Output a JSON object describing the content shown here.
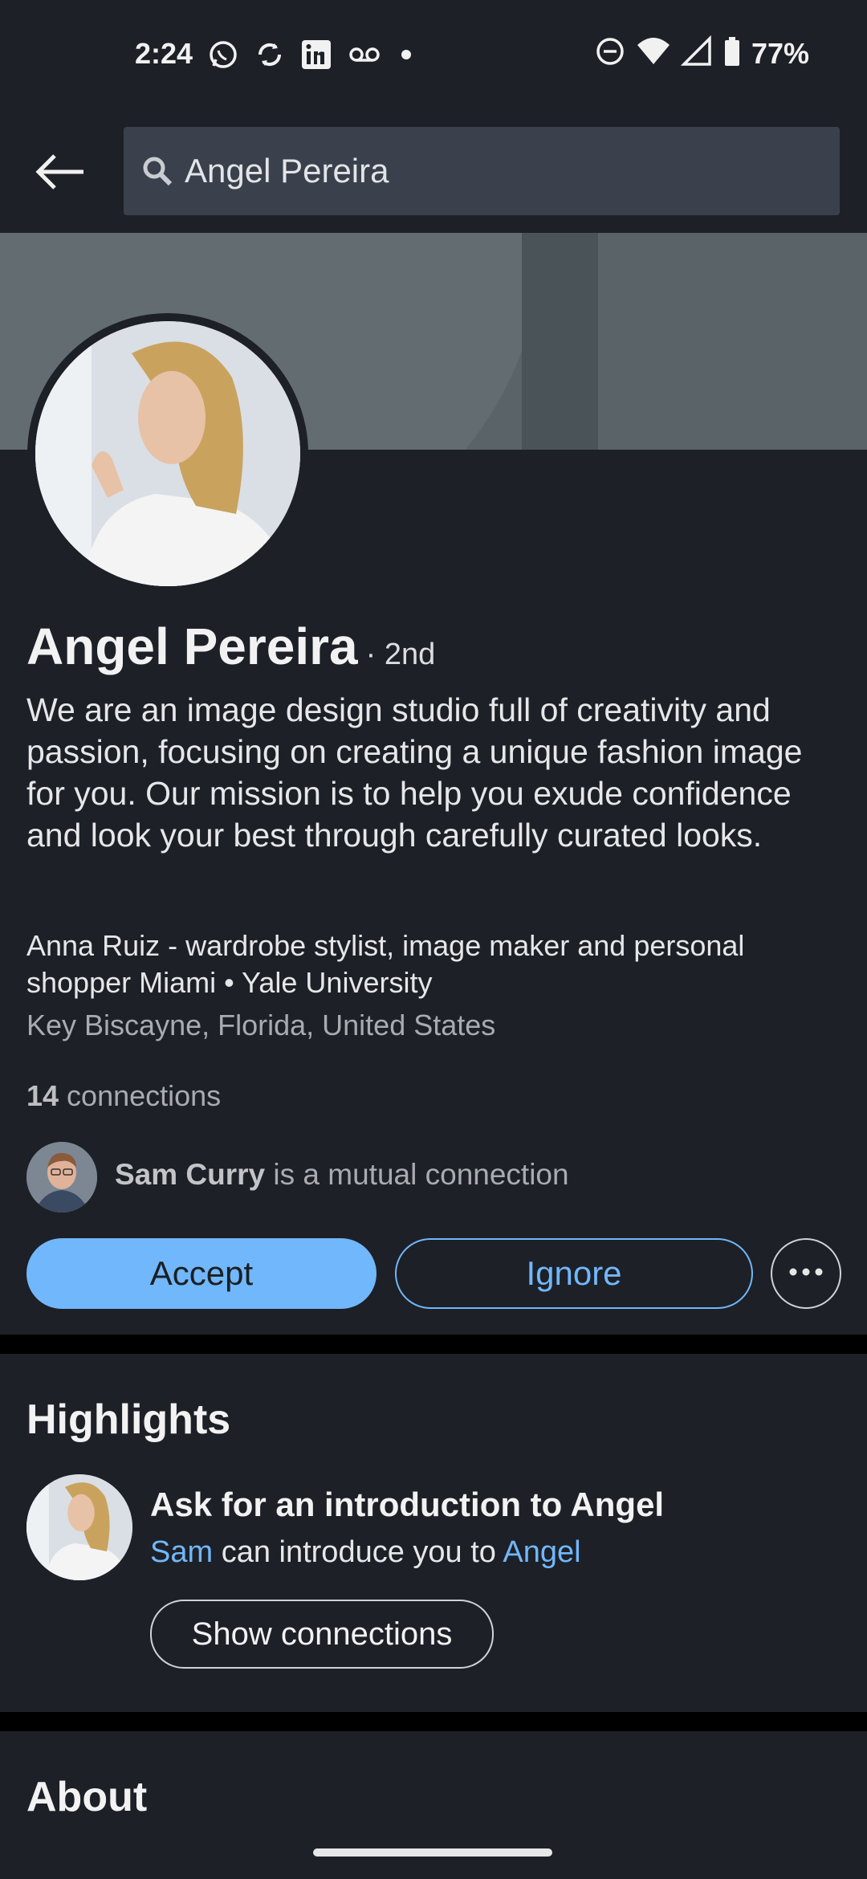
{
  "status_bar": {
    "time": "2:24",
    "battery": "77%",
    "left_icons": [
      "whatsapp-icon",
      "sync-icon",
      "linkedin-icon",
      "voicemail-icon",
      "dot-icon"
    ],
    "right_icons": [
      "dnd-icon",
      "wifi-icon",
      "signal-icon",
      "battery-icon"
    ]
  },
  "search": {
    "query": "Angel Pereira"
  },
  "profile": {
    "name": "Angel Pereira",
    "degree": "· 2nd",
    "headline": "We are an image design studio full of creativity and passion, focusing on creating a unique fashion image for you. Our mission is to help you exude confidence and look your best through carefully curated looks.",
    "job": "Anna Ruiz - wardrobe stylist, image maker and personal shopper Miami • Yale University",
    "location": "Key Biscayne, Florida, United States",
    "connections_count": "14",
    "connections_label": " connections",
    "mutual_name": "Sam Curry",
    "mutual_suffix": " is a mutual connection"
  },
  "actions": {
    "accept": "Accept",
    "ignore": "Ignore"
  },
  "highlights": {
    "title": "Highlights",
    "intro_title": "Ask for an introduction to Angel",
    "intro_from": "Sam",
    "intro_middle": " can introduce you to ",
    "intro_to": "Angel",
    "show_connections": "Show connections"
  },
  "about": {
    "title": "About"
  },
  "colors": {
    "background": "#1d2026",
    "accent": "#71b7fb",
    "search_bg": "#3a414c"
  }
}
